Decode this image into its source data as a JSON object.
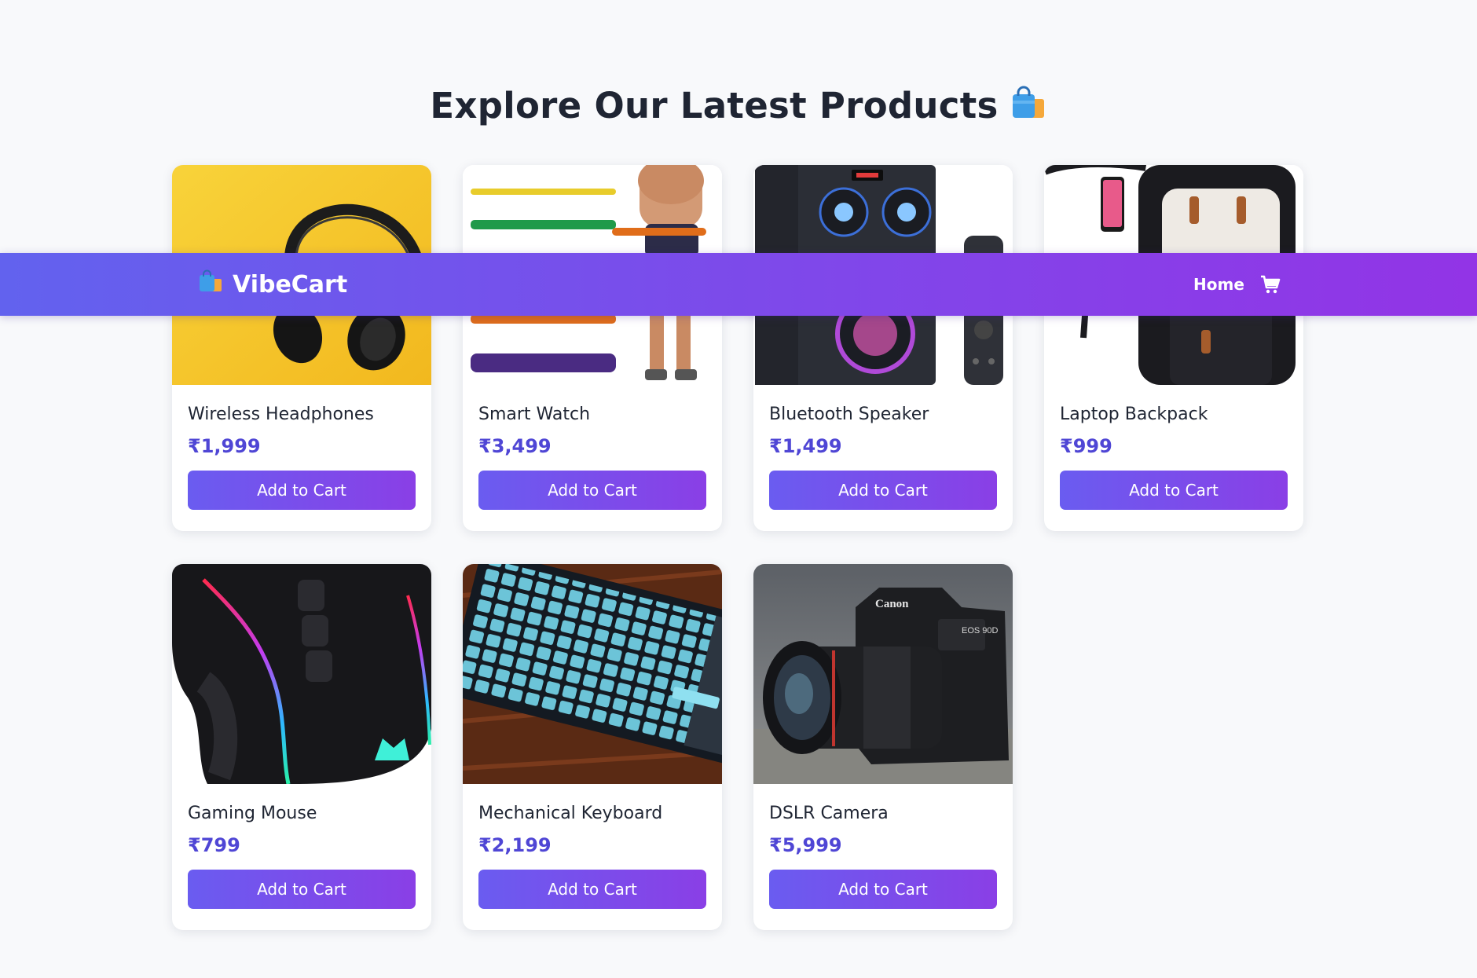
{
  "page_title": "Explore Our Latest Products",
  "nav": {
    "brand": "VibeCart",
    "links": [
      {
        "label": "Home"
      }
    ],
    "icons": [
      "shopping-bags-icon",
      "cart-icon"
    ]
  },
  "products": [
    {
      "name": "Wireless Headphones",
      "price": "₹1,999",
      "button": "Add to Cart",
      "image": "headphones-image"
    },
    {
      "name": "Smart Watch",
      "price": "₹3,499",
      "button": "Add to Cart",
      "image": "resistance-bands-image"
    },
    {
      "name": "Bluetooth Speaker",
      "price": "₹1,499",
      "button": "Add to Cart",
      "image": "speaker-image"
    },
    {
      "name": "Laptop Backpack",
      "price": "₹999",
      "button": "Add to Cart",
      "image": "backpack-image"
    },
    {
      "name": "Gaming Mouse",
      "price": "₹799",
      "button": "Add to Cart",
      "image": "gaming-mouse-image"
    },
    {
      "name": "Mechanical Keyboard",
      "price": "₹2,199",
      "button": "Add to Cart",
      "image": "keyboard-image"
    },
    {
      "name": "DSLR Camera",
      "price": "₹5,999",
      "button": "Add to Cart",
      "image": "camera-image"
    }
  ],
  "image_labels": {
    "camera_brand": "Canon",
    "camera_model": "EOS 90D"
  },
  "colors": {
    "accent_start": "#6a5cf0",
    "accent_end": "#8a3fe6",
    "price": "#4f46d5",
    "background": "#f8f9fb"
  }
}
